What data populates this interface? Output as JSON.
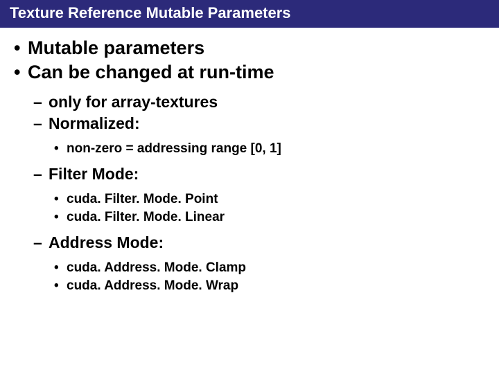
{
  "title": "Texture Reference Mutable Parameters",
  "bullets": {
    "l1a": "Mutable parameters",
    "l1b": "Can be changed at run-time",
    "l2a": "only for array-textures",
    "l2b": "Normalized:",
    "l3a": "non-zero = addressing range [0, 1]",
    "l2c": "Filter Mode:",
    "l3b": "cuda. Filter. Mode. Point",
    "l3c": "cuda. Filter. Mode. Linear",
    "l2d": "Address Mode:",
    "l3d": "cuda. Address. Mode. Clamp",
    "l3e": "cuda. Address. Mode. Wrap"
  },
  "glyphs": {
    "dot": "•",
    "dash": "–"
  }
}
